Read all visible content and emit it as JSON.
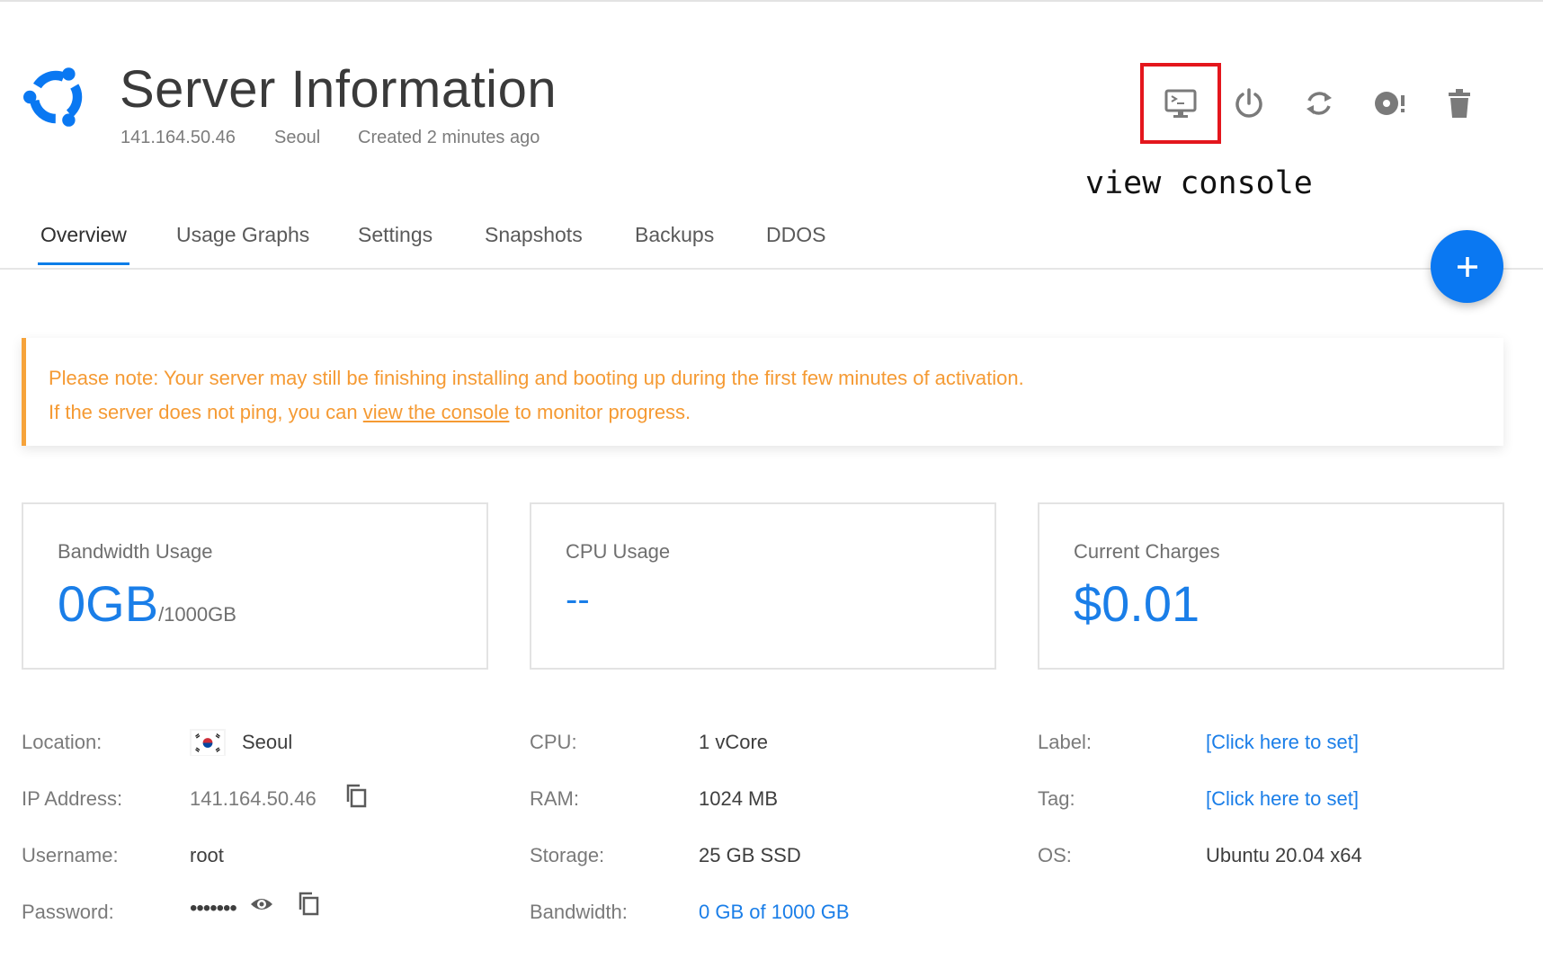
{
  "header": {
    "title": "Server Information",
    "ip": "141.164.50.46",
    "location": "Seoul",
    "created": "Created 2 minutes ago"
  },
  "actions": [
    {
      "name": "view-console",
      "icon": "monitor-terminal-icon"
    },
    {
      "name": "power",
      "icon": "power-icon"
    },
    {
      "name": "restart",
      "icon": "restart-icon"
    },
    {
      "name": "iso",
      "icon": "disc-icon"
    },
    {
      "name": "destroy",
      "icon": "trash-icon"
    }
  ],
  "annotation": "view console",
  "tabs": [
    {
      "label": "Overview",
      "active": true
    },
    {
      "label": "Usage Graphs"
    },
    {
      "label": "Settings"
    },
    {
      "label": "Snapshots"
    },
    {
      "label": "Backups"
    },
    {
      "label": "DDOS"
    }
  ],
  "fab": {
    "icon": "plus-icon"
  },
  "notice": {
    "line1": "Please note: Your server may still be finishing installing and booting up during the first few minutes of activation.",
    "line2_before": "If the server does not ping, you can ",
    "line2_link": "view the console",
    "line2_after": " to monitor progress."
  },
  "cards": {
    "bandwidth": {
      "label": "Bandwidth Usage",
      "value": "0GB",
      "unit": "/1000GB"
    },
    "cpu": {
      "label": "CPU Usage",
      "value": "--"
    },
    "charges": {
      "label": "Current Charges",
      "value": "$0.01"
    }
  },
  "details": {
    "location_label": "Location:",
    "location_value": "Seoul",
    "ip_label": "IP Address:",
    "ip_value": "141.164.50.46",
    "username_label": "Username:",
    "username_value": "root",
    "password_label": "Password:",
    "password_value": "•••••••",
    "cpu_label": "CPU:",
    "cpu_value": "1 vCore",
    "ram_label": "RAM:",
    "ram_value": "1024 MB",
    "storage_label": "Storage:",
    "storage_value": "25 GB SSD",
    "bandwidth_label": "Bandwidth:",
    "bandwidth_value": "0 GB of 1000 GB",
    "label_label": "Label:",
    "label_value": "[Click here to set]",
    "tag_label": "Tag:",
    "tag_value": "[Click here to set]",
    "os_label": "OS:",
    "os_value": "Ubuntu 20.04 x64"
  },
  "colors": {
    "accent": "#1a7ee8",
    "warning": "#f59a33",
    "highlight": "#e4161d"
  }
}
